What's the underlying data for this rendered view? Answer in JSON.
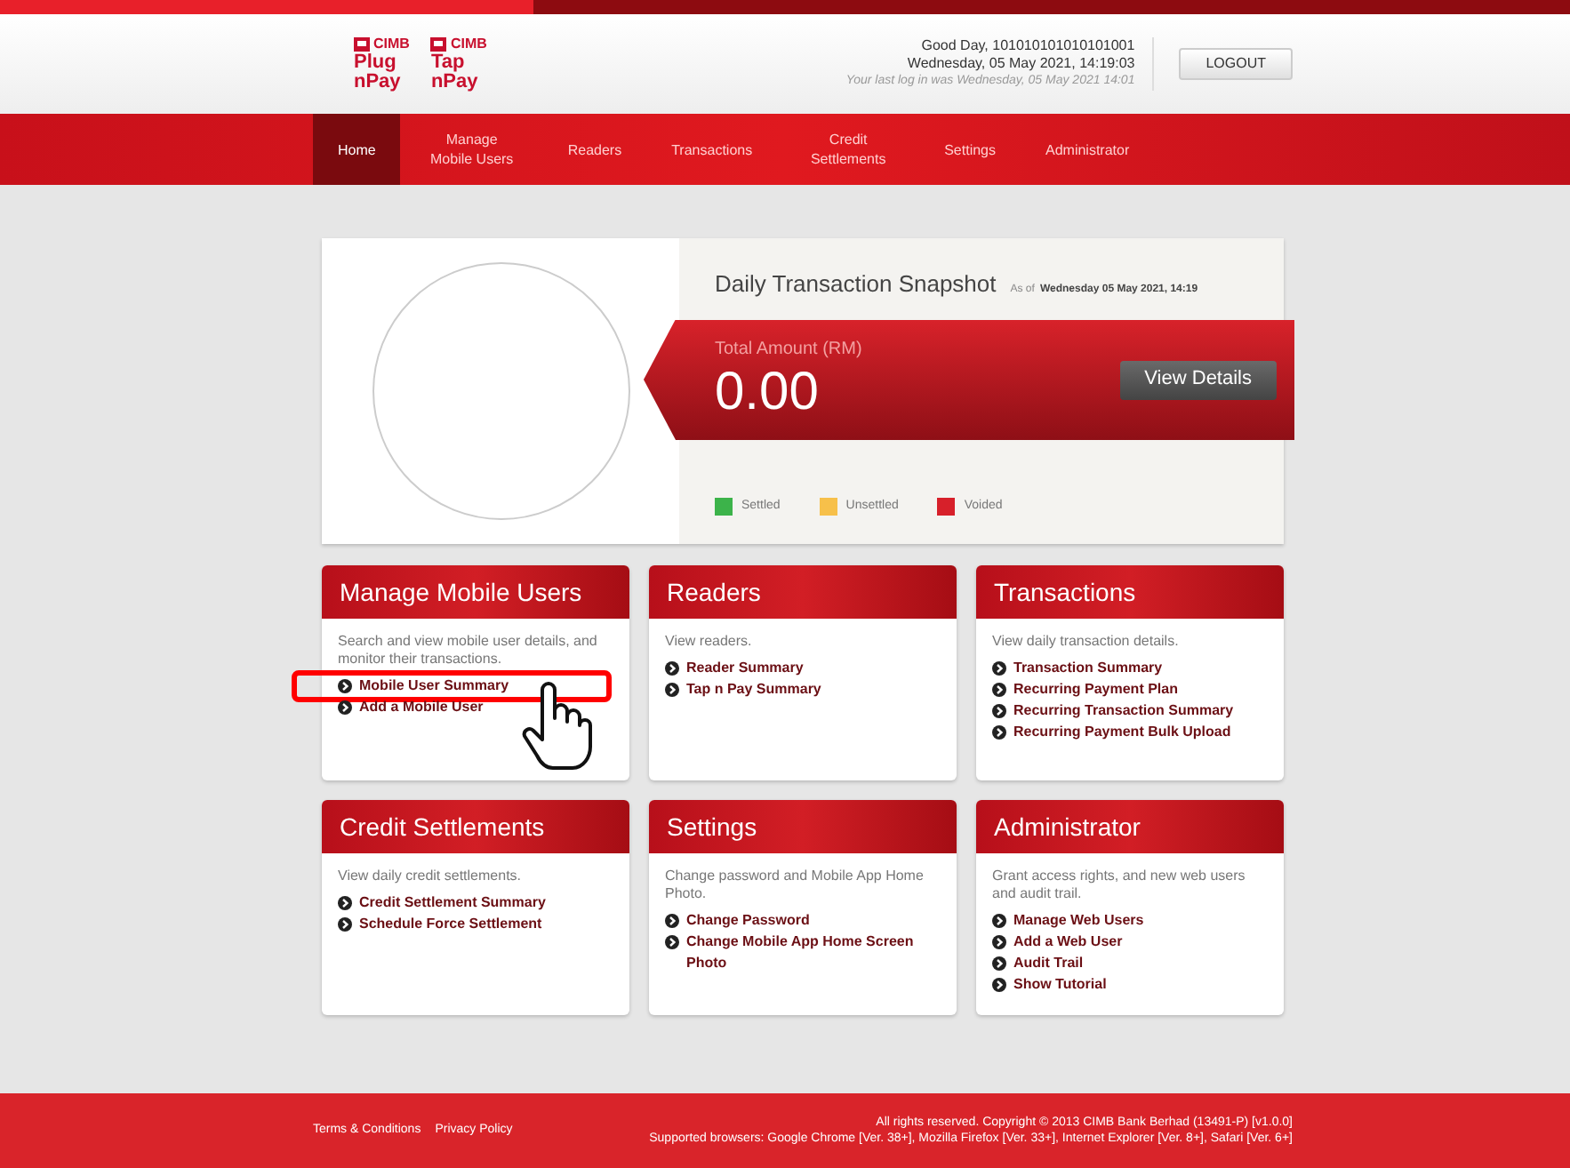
{
  "header": {
    "logos": [
      {
        "brand": "CIMB",
        "line_1": "Plug",
        "line_2": "nPay"
      },
      {
        "brand": "CIMB",
        "line_1": "Tap",
        "line_2": "nPay"
      }
    ],
    "greeting": "Good Day, 101010101010101001",
    "datetime": "Wednesday, 05 May 2021, 14:19:03",
    "last_login": "Your last log in was Wednesday, 05 May 2021 14:01",
    "logout": "LOGOUT"
  },
  "nav": [
    {
      "label": "Home",
      "selected": true
    },
    {
      "label": "Manage Mobile Users",
      "selected": false
    },
    {
      "label": "Readers",
      "selected": false
    },
    {
      "label": "Transactions",
      "selected": false
    },
    {
      "label": "Credit Settlements",
      "selected": false
    },
    {
      "label": "Settings",
      "selected": false
    },
    {
      "label": "Administrator",
      "selected": false
    }
  ],
  "snapshot": {
    "title": "Daily Transaction Snapshot",
    "as_of_label": "As of",
    "as_of": "Wednesday 05 May 2021, 14:19",
    "total_label": "Total Amount (RM)",
    "total": "0.00",
    "button": "View Details",
    "legend": [
      {
        "label": "Settled",
        "color": "#3cb34a"
      },
      {
        "label": "Unsettled",
        "color": "#f7c04a"
      },
      {
        "label": "Voided",
        "color": "#d7202a"
      }
    ]
  },
  "cards": [
    {
      "title": "Manage Mobile Users",
      "description": "Search and view mobile user details, and monitor their transactions.",
      "links": [
        {
          "label": "Mobile User Summary",
          "highlighted": true
        },
        {
          "label": "Add a Mobile User",
          "highlighted": false
        }
      ]
    },
    {
      "title": "Readers",
      "description": "View readers.",
      "links": [
        {
          "label": "Reader Summary",
          "highlighted": false
        },
        {
          "label": "Tap n Pay Summary",
          "highlighted": false
        }
      ]
    },
    {
      "title": "Transactions",
      "description": "View daily transaction details.",
      "links": [
        {
          "label": "Transaction Summary",
          "highlighted": false
        },
        {
          "label": "Recurring Payment Plan",
          "highlighted": false
        },
        {
          "label": "Recurring Transaction Summary",
          "highlighted": false
        },
        {
          "label": "Recurring Payment Bulk Upload",
          "highlighted": false
        }
      ]
    },
    {
      "title": "Credit Settlements",
      "description": "View daily credit settlements.",
      "links": [
        {
          "label": "Credit Settlement Summary",
          "highlighted": false
        },
        {
          "label": "Schedule Force Settlement",
          "highlighted": false
        }
      ]
    },
    {
      "title": "Settings",
      "description": "Change password and Mobile App Home Photo.",
      "links": [
        {
          "label": "Change Password",
          "highlighted": false
        },
        {
          "label": "Change Mobile App Home Screen Photo",
          "highlighted": false
        }
      ]
    },
    {
      "title": "Administrator",
      "description": "Grant access rights, and new web users and audit trail.",
      "links": [
        {
          "label": "Manage Web Users",
          "highlighted": false
        },
        {
          "label": "Add a Web User",
          "highlighted": false
        },
        {
          "label": "Audit Trail",
          "highlighted": false
        },
        {
          "label": "Show Tutorial",
          "highlighted": false
        }
      ]
    }
  ],
  "footer": {
    "links": [
      "Terms & Conditions",
      "Privacy Policy"
    ],
    "copyright": "All rights reserved. Copyright © 2013 CIMB Bank Berhad (13491-P) [v1.0.0]",
    "browsers": "Supported browsers: Google Chrome [Ver. 38+], Mozilla Firefox [Ver. 33+], Internet Explorer [Ver. 8+], Safari [Ver. 6+]"
  }
}
